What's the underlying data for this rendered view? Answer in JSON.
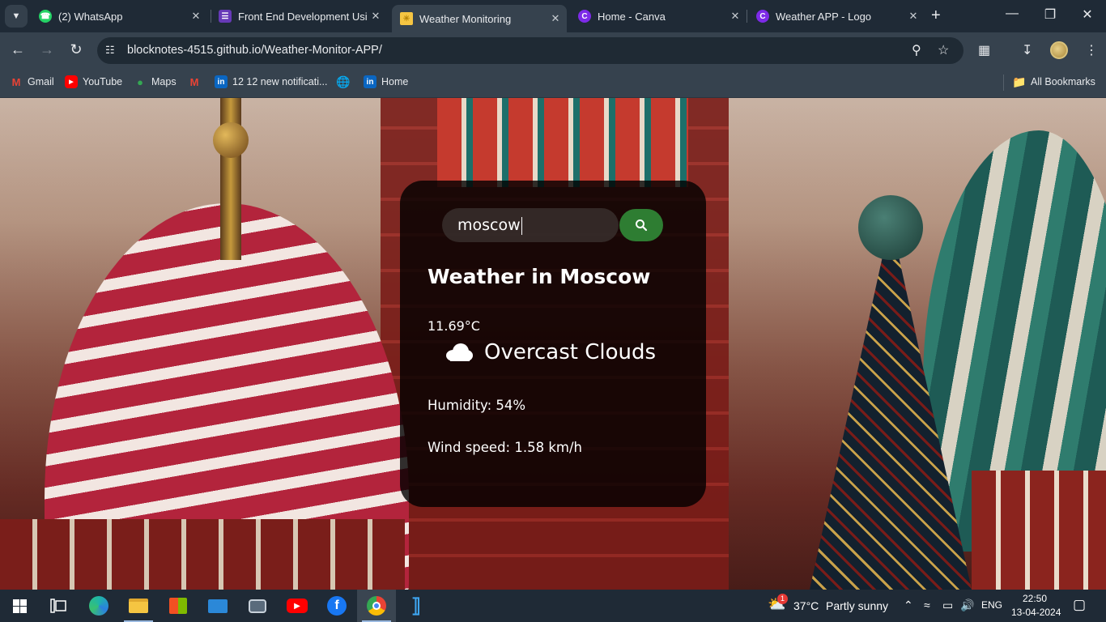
{
  "browser": {
    "tabs": [
      {
        "title": "(2) WhatsApp",
        "icon": "whatsapp-icon",
        "color": "#25d366",
        "active": false
      },
      {
        "title": "Front End Development Usin",
        "icon": "forms-icon",
        "color": "#673ab7",
        "active": false
      },
      {
        "title": "Weather Monitoring",
        "icon": "weather-sun-icon",
        "color": "#f5c542",
        "active": true
      },
      {
        "title": "Home - Canva",
        "icon": "canva-icon",
        "color": "#7d2ae8",
        "active": false
      },
      {
        "title": "Weather APP - Logo",
        "icon": "canva-icon",
        "color": "#7d2ae8",
        "active": false
      }
    ],
    "url": "blocknotes-4515.github.io/Weather-Monitor-APP/",
    "bookmarks": [
      {
        "label": "Gmail",
        "icon": "gmail-icon"
      },
      {
        "label": "YouTube",
        "icon": "youtube-icon"
      },
      {
        "label": "Maps",
        "icon": "maps-icon"
      },
      {
        "label": "",
        "icon": "gmail-icon"
      },
      {
        "label": "12 12 new notificati...",
        "icon": "linkedin-icon"
      },
      {
        "label": "",
        "icon": "globe-icon"
      },
      {
        "label": "Home",
        "icon": "linkedin-icon"
      }
    ],
    "all_bookmarks": "All Bookmarks"
  },
  "weather": {
    "search_value": "moscow",
    "city_title": "Weather in Moscow",
    "temperature": "11.69°C",
    "description": "Overcast Clouds",
    "humidity": "Humidity: 54%",
    "wind": "Wind speed: 1.58 km/h",
    "accent": "#2e7d32"
  },
  "taskbar": {
    "weather_temp": "37°C",
    "weather_text": "Partly sunny",
    "weather_badge": "1",
    "language": "ENG",
    "time": "22:50",
    "date": "13-04-2024"
  }
}
